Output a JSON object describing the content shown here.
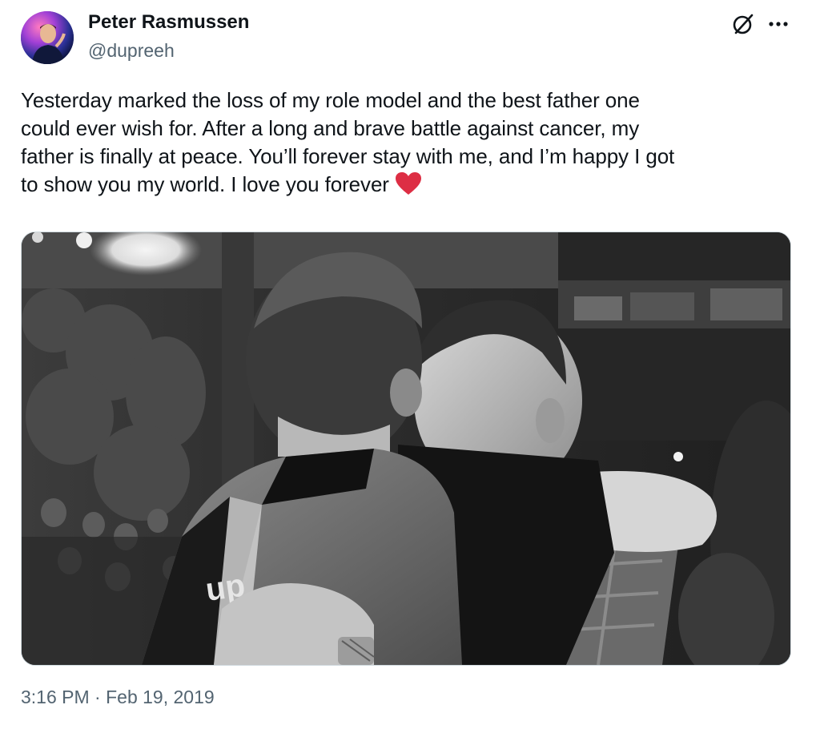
{
  "author": {
    "display_name": "Peter Rasmussen",
    "handle": "@dupreeh",
    "avatar_icon": "profile-photo"
  },
  "header_actions": {
    "grok_icon": "grok-icon",
    "more_icon": "more-options-icon"
  },
  "tweet": {
    "lines": [
      "Yesterday marked the loss of my role model and the best father one",
      "could ever wish for. After a long and brave battle against cancer, my",
      "father is finally at peace. You’ll forever stay with me, and I’m happy I got",
      "to show you my world. I love you forever"
    ],
    "emoji_icon": "red-heart-icon"
  },
  "media": {
    "image_icon": "black-and-white-hug-photo",
    "jersey_text": "up"
  },
  "meta": {
    "time": "3:16 PM",
    "separator": " · ",
    "date": "Feb 19, 2019"
  },
  "colors": {
    "text_primary": "#0f1419",
    "text_secondary": "#536471",
    "heart": "#e0245e",
    "border": "#cfd9de"
  }
}
